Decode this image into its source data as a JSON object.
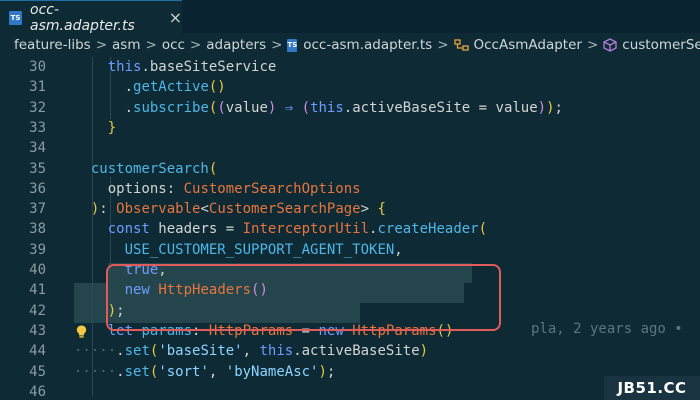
{
  "tab": {
    "icon": "ts-file-icon",
    "icon_text": "TS",
    "title": "occ-asm.adapter.ts",
    "close": "×"
  },
  "breadcrumb": {
    "segments": [
      "feature-libs",
      "asm",
      "occ",
      "adapters",
      "occ-asm.adapter.ts",
      "OccAsmAdapter",
      "customerSearch"
    ],
    "separator": ">"
  },
  "blame": {
    "text": "pla, 2 years ago •",
    "line": 43
  },
  "lines": [
    {
      "num": "30",
      "tokens": [
        {
          "t": "this",
          "c": "kw"
        },
        {
          "t": ".baseSiteService",
          "c": "pl"
        }
      ]
    },
    {
      "num": "31",
      "tokens": [
        {
          "t": ".",
          "c": "pl"
        },
        {
          "t": "getActive",
          "c": "fn"
        },
        {
          "t": "()",
          "c": "br"
        }
      ]
    },
    {
      "num": "32",
      "tokens": [
        {
          "t": ".",
          "c": "pl"
        },
        {
          "t": "subscribe",
          "c": "fn"
        },
        {
          "t": "(",
          "c": "br"
        },
        {
          "t": "(",
          "c": "pr"
        },
        {
          "t": "value",
          "c": "pl"
        },
        {
          "t": ") ",
          "c": "pr"
        },
        {
          "t": "⇒",
          "c": "kw"
        },
        {
          "t": " ",
          "c": "pl"
        },
        {
          "t": "(",
          "c": "pr"
        },
        {
          "t": "this",
          "c": "kw"
        },
        {
          "t": ".activeBaseSite = value",
          "c": "pl"
        },
        {
          "t": ")",
          "c": "pr"
        },
        {
          "t": ")",
          "c": "br"
        },
        {
          "t": ";",
          "c": "pl"
        }
      ]
    },
    {
      "num": "33",
      "tokens": [
        {
          "t": "}",
          "c": "br"
        }
      ]
    },
    {
      "num": "34",
      "tokens": []
    },
    {
      "num": "35",
      "tokens": [
        {
          "t": "customerSearch",
          "c": "fn"
        },
        {
          "t": "(",
          "c": "br"
        }
      ]
    },
    {
      "num": "36",
      "tokens": [
        {
          "t": "options",
          "c": "pl"
        },
        {
          "t": ": ",
          "c": "pl"
        },
        {
          "t": "CustomerSearchOptions",
          "c": "ty"
        }
      ]
    },
    {
      "num": "37",
      "tokens": [
        {
          "t": ")",
          "c": "br"
        },
        {
          "t": ": ",
          "c": "pl"
        },
        {
          "t": "Observable",
          "c": "ty"
        },
        {
          "t": "<",
          "c": "pl"
        },
        {
          "t": "CustomerSearchPage",
          "c": "ty"
        },
        {
          "t": "> ",
          "c": "pl"
        },
        {
          "t": "{",
          "c": "br"
        }
      ]
    },
    {
      "num": "38",
      "tokens": [
        {
          "t": "const",
          "c": "kw"
        },
        {
          "t": " headers = ",
          "c": "pl"
        },
        {
          "t": "InterceptorUtil",
          "c": "ty"
        },
        {
          "t": ".",
          "c": "pl"
        },
        {
          "t": "createHeader",
          "c": "fn"
        },
        {
          "t": "(",
          "c": "br"
        }
      ]
    },
    {
      "num": "39",
      "tokens": [
        {
          "t": "USE_CUSTOMER_SUPPORT_AGENT_TOKEN",
          "c": "fn"
        },
        {
          "t": ",",
          "c": "pl"
        }
      ]
    },
    {
      "num": "40",
      "tokens": [
        {
          "t": "true",
          "c": "kw"
        },
        {
          "t": ",",
          "c": "pl"
        }
      ]
    },
    {
      "num": "41",
      "tokens": [
        {
          "t": "new",
          "c": "kw"
        },
        {
          "t": " ",
          "c": "pl"
        },
        {
          "t": "HttpHeaders",
          "c": "ty"
        },
        {
          "t": "()",
          "c": "pr"
        }
      ]
    },
    {
      "num": "42",
      "tokens": [
        {
          "t": ")",
          "c": "br"
        },
        {
          "t": ";",
          "c": "pl"
        }
      ]
    },
    {
      "num": "43",
      "tokens": [
        {
          "t": "let",
          "c": "kw"
        },
        {
          "t": " params",
          "c": "fn"
        },
        {
          "t": ": ",
          "c": "pl"
        },
        {
          "t": "HttpParams",
          "c": "ty"
        },
        {
          "t": " = ",
          "c": "pl"
        },
        {
          "t": "new",
          "c": "kw"
        },
        {
          "t": " ",
          "c": "pl"
        },
        {
          "t": "HttpParams",
          "c": "ty"
        },
        {
          "t": "()",
          "c": "br"
        }
      ]
    },
    {
      "num": "44",
      "tokens": [
        {
          "t": ".",
          "c": "pl"
        },
        {
          "t": "set",
          "c": "fn"
        },
        {
          "t": "(",
          "c": "br"
        },
        {
          "t": "'baseSite'",
          "c": "st"
        },
        {
          "t": ", ",
          "c": "pl"
        },
        {
          "t": "this",
          "c": "kw"
        },
        {
          "t": ".activeBaseSite",
          "c": "pl"
        },
        {
          "t": ")",
          "c": "br"
        }
      ]
    },
    {
      "num": "45",
      "tokens": [
        {
          "t": ".",
          "c": "pl"
        },
        {
          "t": "set",
          "c": "fn"
        },
        {
          "t": "(",
          "c": "br"
        },
        {
          "t": "'sort'",
          "c": "st"
        },
        {
          "t": ", ",
          "c": "pl"
        },
        {
          "t": "'byNameAsc'",
          "c": "st"
        },
        {
          "t": ")",
          "c": "br"
        },
        {
          "t": ";",
          "c": "pl"
        }
      ]
    },
    {
      "num": "46",
      "tokens": []
    }
  ],
  "watermark": "JB51.CC"
}
